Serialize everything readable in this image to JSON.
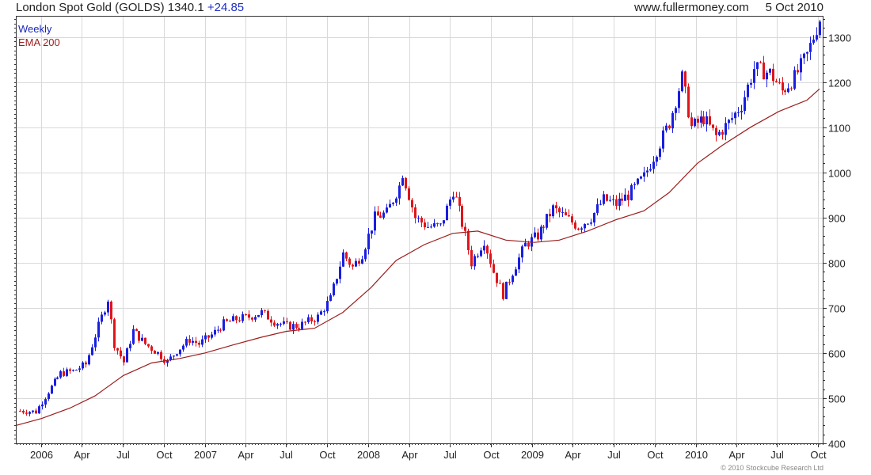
{
  "header": {
    "title": "London Spot Gold (GOLDS)",
    "last": "1340.1",
    "change": "+24.85",
    "source": "www.fullermoney.com",
    "date": "5 Oct 2010"
  },
  "legend": {
    "weekly": "Weekly",
    "ema": "EMA 200"
  },
  "copyright": "© 2010 Stockcube Research Ltd",
  "colors": {
    "up": "#1a1ee0",
    "down": "#e0141a",
    "ema": "#9c1d1d",
    "grid": "#d9d9d9",
    "axis": "#333333"
  },
  "chart_data": {
    "type": "line",
    "title": "London Spot Gold (GOLDS)",
    "series": [
      {
        "name": "Weekly",
        "x": [
          "2005-11-14",
          "2005-12-19",
          "2006-01-16",
          "2006-02-13",
          "2006-03-13",
          "2006-04-10",
          "2006-05-08",
          "2006-05-29",
          "2006-06-12",
          "2006-07-03",
          "2006-07-24",
          "2006-08-21",
          "2006-09-18",
          "2006-10-09",
          "2006-10-30",
          "2006-11-27",
          "2006-12-18",
          "2007-01-15",
          "2007-02-12",
          "2007-03-12",
          "2007-04-09",
          "2007-05-07",
          "2007-06-04",
          "2007-07-02",
          "2007-07-30",
          "2007-08-20",
          "2007-09-10",
          "2007-10-08",
          "2007-11-05",
          "2007-11-26",
          "2007-12-17",
          "2008-01-14",
          "2008-02-11",
          "2008-03-10",
          "2008-03-17",
          "2008-04-14",
          "2008-05-12",
          "2008-06-09",
          "2008-07-07",
          "2008-07-14",
          "2008-08-04",
          "2008-08-18",
          "2008-09-15",
          "2008-10-06",
          "2008-10-27",
          "2008-11-17",
          "2008-12-15",
          "2009-01-12",
          "2009-02-16",
          "2009-03-16",
          "2009-04-13",
          "2009-05-11",
          "2009-06-08",
          "2009-07-06",
          "2009-08-03",
          "2009-09-07",
          "2009-10-05",
          "2009-11-02",
          "2009-11-30",
          "2009-12-21",
          "2010-01-18",
          "2010-02-15",
          "2010-03-15",
          "2010-04-12",
          "2010-05-10",
          "2010-06-14",
          "2010-07-12",
          "2010-08-09",
          "2010-09-06",
          "2010-10-04"
        ],
        "values": [
          472,
          470,
          515,
          555,
          560,
          575,
          660,
          720,
          620,
          580,
          650,
          620,
          600,
          580,
          605,
          630,
          620,
          640,
          665,
          675,
          680,
          690,
          670,
          660,
          660,
          670,
          680,
          720,
          820,
          790,
          820,
          900,
          910,
          970,
          1000,
          900,
          880,
          880,
          960,
          940,
          860,
          800,
          850,
          780,
          730,
          780,
          840,
          860,
          920,
          900,
          880,
          900,
          940,
          930,
          950,
          990,
          1050,
          1110,
          1210,
          1100,
          1120,
          1080,
          1110,
          1150,
          1230,
          1220,
          1180,
          1210,
          1260,
          1340
        ]
      },
      {
        "name": "EMA 200",
        "x": [
          "2005-11-07",
          "2006-01-02",
          "2006-03-06",
          "2006-05-01",
          "2006-07-03",
          "2006-09-04",
          "2006-11-06",
          "2007-01-01",
          "2007-03-05",
          "2007-05-07",
          "2007-07-02",
          "2007-09-03",
          "2007-11-05",
          "2008-01-07",
          "2008-03-03",
          "2008-05-05",
          "2008-07-07",
          "2008-09-01",
          "2008-11-03",
          "2009-01-05",
          "2009-03-02",
          "2009-05-04",
          "2009-07-06",
          "2009-09-07",
          "2009-11-02",
          "2010-01-04",
          "2010-03-01",
          "2010-05-03",
          "2010-07-05",
          "2010-09-06",
          "2010-10-04"
        ],
        "values": [
          440,
          455,
          478,
          505,
          550,
          578,
          588,
          600,
          618,
          635,
          648,
          655,
          690,
          745,
          805,
          840,
          865,
          870,
          850,
          845,
          850,
          870,
          895,
          915,
          955,
          1020,
          1060,
          1100,
          1135,
          1160,
          1185
        ]
      }
    ],
    "x_ticks": [
      "2006",
      "Apr",
      "Jul",
      "Oct",
      "2007",
      "Apr",
      "Jul",
      "Oct",
      "2008",
      "Apr",
      "Jul",
      "Oct",
      "2009",
      "Apr",
      "Jul",
      "Oct",
      "2010",
      "Apr",
      "Jul",
      "Oct"
    ],
    "y_ticks": [
      "400",
      "500",
      "600",
      "700",
      "800",
      "900",
      "1000",
      "1100",
      "1200",
      "1300"
    ],
    "ylim": [
      400,
      1345
    ],
    "xlim": [
      "2005-11-07",
      "2010-10-11"
    ],
    "grid": true,
    "legend": "top-left"
  }
}
